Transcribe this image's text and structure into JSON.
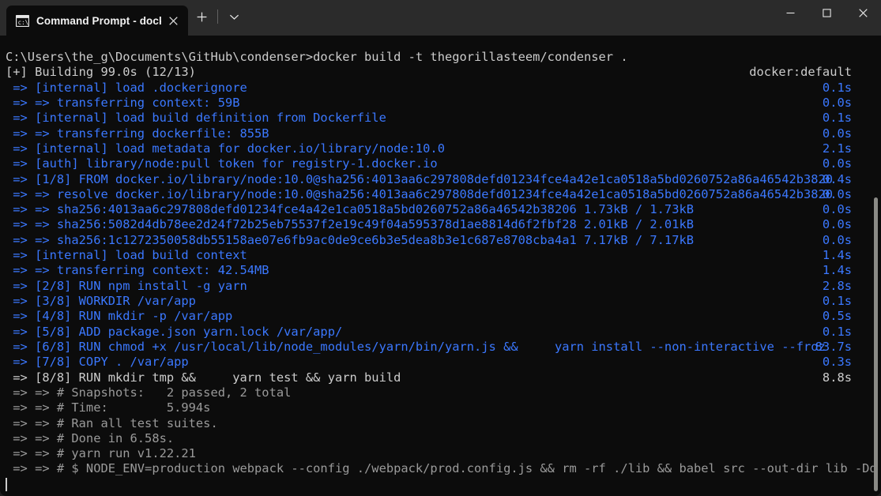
{
  "window": {
    "minimize_label": "Minimize",
    "maximize_label": "Maximize",
    "close_label": "Close"
  },
  "tabbar": {
    "tab_title": "Command Prompt - docker  b",
    "tab_icon": "command-prompt-icon",
    "close_icon": "close-icon",
    "new_tab_icon": "plus-icon",
    "dropdown_icon": "chevron-down-icon"
  },
  "colors": {
    "titlebar_bg": "#2b2b2b",
    "terminal_bg": "#0c0c0c",
    "build_blue": "#3b78ff",
    "text_white": "#cccccc",
    "text_gray": "#9a9a9a",
    "scrollbar": "#8a8a86"
  },
  "terminal": {
    "prompt_path": "C:\\Users\\the_g\\Documents\\GitHub\\condenser>",
    "command": "docker build -t thegorillasteem/condenser .",
    "builder": "docker:default",
    "summary": "[+] Building 99.0s (12/13)",
    "cursor_visible": true,
    "lines": [
      {
        "text": "C:\\Users\\the_g\\Documents\\GitHub\\condenser>docker build -t thegorillasteem/condenser .",
        "color": "white",
        "time": "",
        "time_color": ""
      },
      {
        "text": "[+] Building 99.0s (12/13)",
        "color": "white",
        "time": "docker:default",
        "time_color": "white"
      },
      {
        "text": " => [internal] load .dockerignore",
        "color": "blue",
        "time": "0.1s",
        "time_color": "blue"
      },
      {
        "text": " => => transferring context: 59B",
        "color": "blue",
        "time": "0.0s",
        "time_color": "blue"
      },
      {
        "text": " => [internal] load build definition from Dockerfile",
        "color": "blue",
        "time": "0.1s",
        "time_color": "blue"
      },
      {
        "text": " => => transferring dockerfile: 855B",
        "color": "blue",
        "time": "0.0s",
        "time_color": "blue"
      },
      {
        "text": " => [internal] load metadata for docker.io/library/node:10.0",
        "color": "blue",
        "time": "2.1s",
        "time_color": "blue"
      },
      {
        "text": " => [auth] library/node:pull token for registry-1.docker.io",
        "color": "blue",
        "time": "0.0s",
        "time_color": "blue"
      },
      {
        "text": " => [1/8] FROM docker.io/library/node:10.0@sha256:4013aa6c297808defd01234fce4a42e1ca0518a5bd0260752a86a46542b3820",
        "color": "blue",
        "time": "0.4s",
        "time_color": "blue"
      },
      {
        "text": " => => resolve docker.io/library/node:10.0@sha256:4013aa6c297808defd01234fce4a42e1ca0518a5bd0260752a86a46542b3820",
        "color": "blue",
        "time": "0.0s",
        "time_color": "blue"
      },
      {
        "text": " => => sha256:4013aa6c297808defd01234fce4a42e1ca0518a5bd0260752a86a46542b38206 1.73kB / 1.73kB",
        "color": "blue",
        "time": "0.0s",
        "time_color": "blue"
      },
      {
        "text": " => => sha256:5082d4db78ee2d24f72b25eb75537f2e19c49f04a595378d1ae8814d6f2fbf28 2.01kB / 2.01kB",
        "color": "blue",
        "time": "0.0s",
        "time_color": "blue"
      },
      {
        "text": " => => sha256:1c1272350058db55158ae07e6fb9ac0de9ce6b3e5dea8b3e1c687e8708cba4a1 7.17kB / 7.17kB",
        "color": "blue",
        "time": "0.0s",
        "time_color": "blue"
      },
      {
        "text": " => [internal] load build context",
        "color": "blue",
        "time": "1.4s",
        "time_color": "blue"
      },
      {
        "text": " => => transferring context: 42.54MB",
        "color": "blue",
        "time": "1.4s",
        "time_color": "blue"
      },
      {
        "text": " => [2/8] RUN npm install -g yarn",
        "color": "blue",
        "time": "2.8s",
        "time_color": "blue"
      },
      {
        "text": " => [3/8] WORKDIR /var/app",
        "color": "blue",
        "time": "0.1s",
        "time_color": "blue"
      },
      {
        "text": " => [4/8] RUN mkdir -p /var/app",
        "color": "blue",
        "time": "0.5s",
        "time_color": "blue"
      },
      {
        "text": " => [5/8] ADD package.json yarn.lock /var/app/",
        "color": "blue",
        "time": "0.1s",
        "time_color": "blue"
      },
      {
        "text": " => [6/8] RUN chmod +x /usr/local/lib/node_modules/yarn/bin/yarn.js &&     yarn install --non-interactive --froz",
        "color": "blue",
        "time": "83.7s",
        "time_color": "blue"
      },
      {
        "text": " => [7/8] COPY . /var/app",
        "color": "blue",
        "time": "0.3s",
        "time_color": "blue"
      },
      {
        "text": " => [8/8] RUN mkdir tmp &&     yarn test && yarn build",
        "color": "white",
        "time": "8.8s",
        "time_color": "white"
      },
      {
        "text": " => => # Snapshots:   2 passed, 2 total",
        "color": "gray",
        "time": "",
        "time_color": ""
      },
      {
        "text": " => => # Time:        5.994s",
        "color": "gray",
        "time": "",
        "time_color": ""
      },
      {
        "text": " => => # Ran all test suites.",
        "color": "gray",
        "time": "",
        "time_color": ""
      },
      {
        "text": " => => # Done in 6.58s.",
        "color": "gray",
        "time": "",
        "time_color": ""
      },
      {
        "text": " => => # yarn run v1.22.21",
        "color": "gray",
        "time": "",
        "time_color": ""
      },
      {
        "text": " => => # $ NODE_ENV=production webpack --config ./webpack/prod.config.js && rm -rf ./lib && babel src --out-dir lib -Dq",
        "color": "gray",
        "time": "",
        "time_color": ""
      }
    ]
  }
}
